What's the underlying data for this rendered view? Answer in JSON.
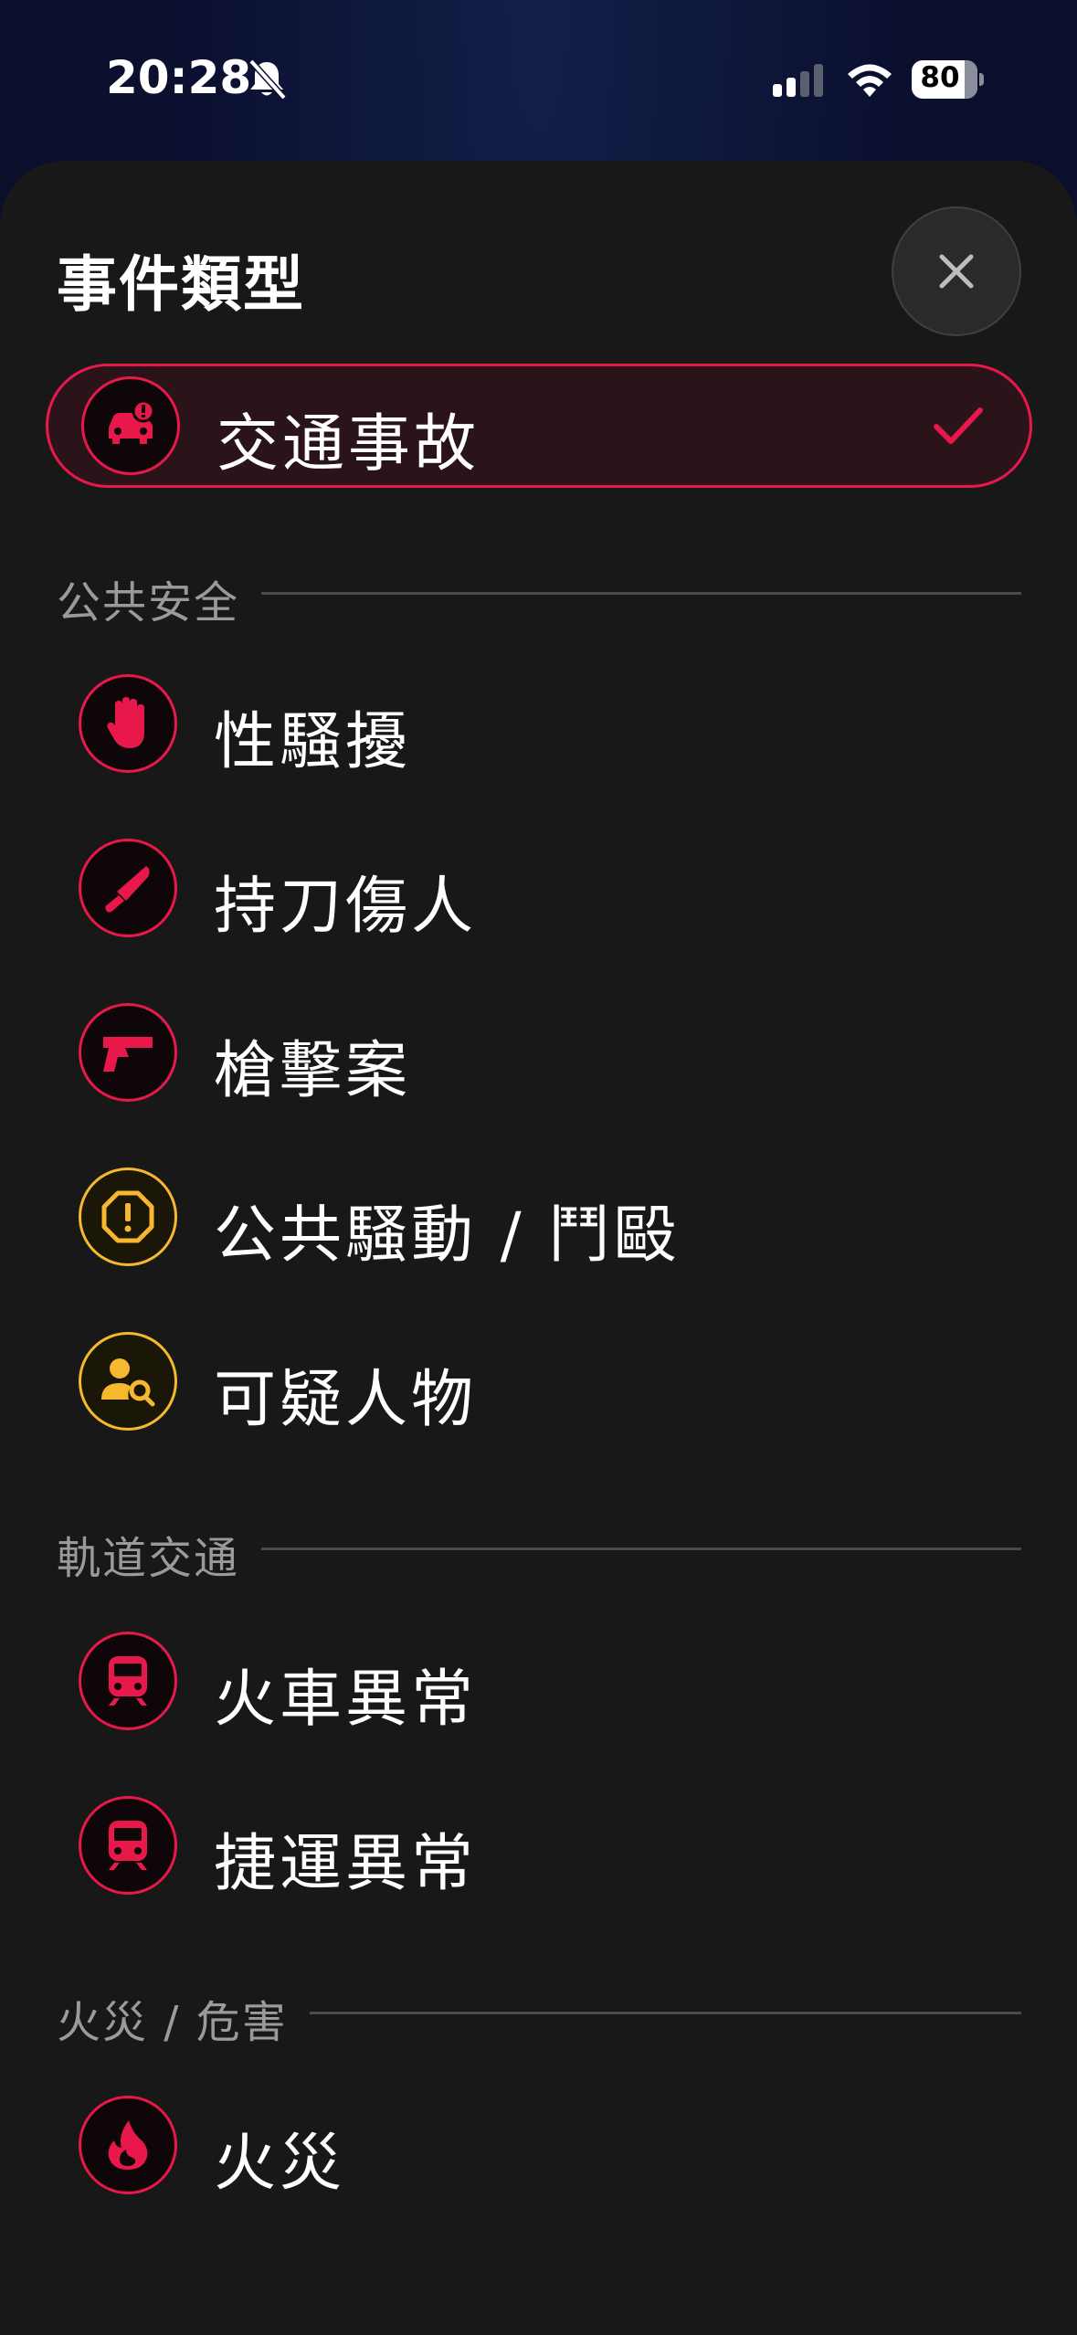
{
  "status_bar": {
    "time": "20:28",
    "battery": "80",
    "bell_icon": "bell-slash-icon",
    "signal_icon": "cellular-signal-icon",
    "wifi_icon": "wifi-icon"
  },
  "sheet": {
    "title": "事件類型",
    "close_icon": "close-icon"
  },
  "selected_item": {
    "label": "交通事故",
    "icon": "car-crash-icon",
    "check_icon": "checkmark-icon"
  },
  "sections": [
    {
      "title": "公共安全",
      "items": [
        {
          "label": "性騷擾",
          "icon": "hand-stop-icon",
          "color": "#e8194a"
        },
        {
          "label": "持刀傷人",
          "icon": "knife-icon",
          "color": "#e8194a"
        },
        {
          "label": "槍擊案",
          "icon": "gun-icon",
          "color": "#e8194a"
        },
        {
          "label": "公共騷動 / 鬥毆",
          "icon": "alert-octagon-icon",
          "color": "#f5b82e"
        },
        {
          "label": "可疑人物",
          "icon": "person-search-icon",
          "color": "#f5b82e"
        }
      ]
    },
    {
      "title": "軌道交通",
      "items": [
        {
          "label": "火車異常",
          "icon": "train-icon",
          "color": "#e8194a"
        },
        {
          "label": "捷運異常",
          "icon": "train-icon",
          "color": "#e8194a"
        }
      ]
    },
    {
      "title": "火災 / 危害",
      "items": [
        {
          "label": "火災",
          "icon": "fire-icon",
          "color": "#e8194a"
        }
      ]
    }
  ],
  "colors": {
    "accent_red": "#e8194a",
    "accent_yellow": "#f5b82e",
    "sheet_bg": "#181818"
  }
}
